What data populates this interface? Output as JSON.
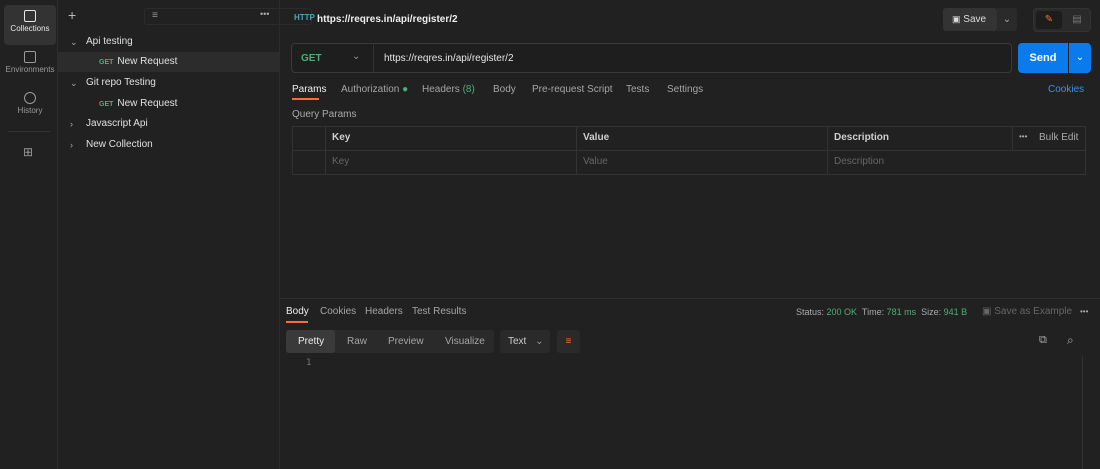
{
  "rail": {
    "items": [
      {
        "label": "Collections",
        "icon": "collections-icon"
      },
      {
        "label": "Environments",
        "icon": "environments-icon"
      },
      {
        "label": "History",
        "icon": "history-icon"
      }
    ]
  },
  "collections": [
    {
      "name": "Api testing",
      "expanded": true,
      "children": [
        {
          "method": "GET",
          "name": "New Request"
        }
      ]
    },
    {
      "name": "Git repo Testing",
      "expanded": true,
      "children": [
        {
          "method": "GET",
          "name": "New Request"
        }
      ]
    },
    {
      "name": "Javascript Api",
      "expanded": false
    },
    {
      "name": "New Collection",
      "expanded": false
    }
  ],
  "request": {
    "title": "https://reqres.in/api/register/2",
    "method": "GET",
    "url": "https://reqres.in/api/register/2",
    "save_label": "Save",
    "send_label": "Send"
  },
  "tabs": {
    "params": "Params",
    "authorization": "Authorization",
    "headers": "Headers",
    "headers_count": "(8)",
    "body": "Body",
    "prerequest": "Pre-request Script",
    "tests": "Tests",
    "settings": "Settings",
    "cookies": "Cookies"
  },
  "query": {
    "title": "Query Params",
    "columns": [
      "Key",
      "Value",
      "Description"
    ],
    "bulk_edit": "Bulk Edit",
    "placeholders": [
      "Key",
      "Value",
      "Description"
    ]
  },
  "response": {
    "tabs": [
      "Body",
      "Cookies",
      "Headers",
      "Test Results"
    ],
    "status_label": "Status:",
    "status": "200 OK",
    "time_label": "Time:",
    "time": "781 ms",
    "size_label": "Size:",
    "size": "941 B",
    "save_example": "Save as Example",
    "views": [
      "Pretty",
      "Raw",
      "Preview",
      "Visualize"
    ],
    "format": "Text",
    "line": "1"
  },
  "colors": {
    "accent": "#ff6c37",
    "send": "#097bed",
    "green": "#4caf7a"
  }
}
